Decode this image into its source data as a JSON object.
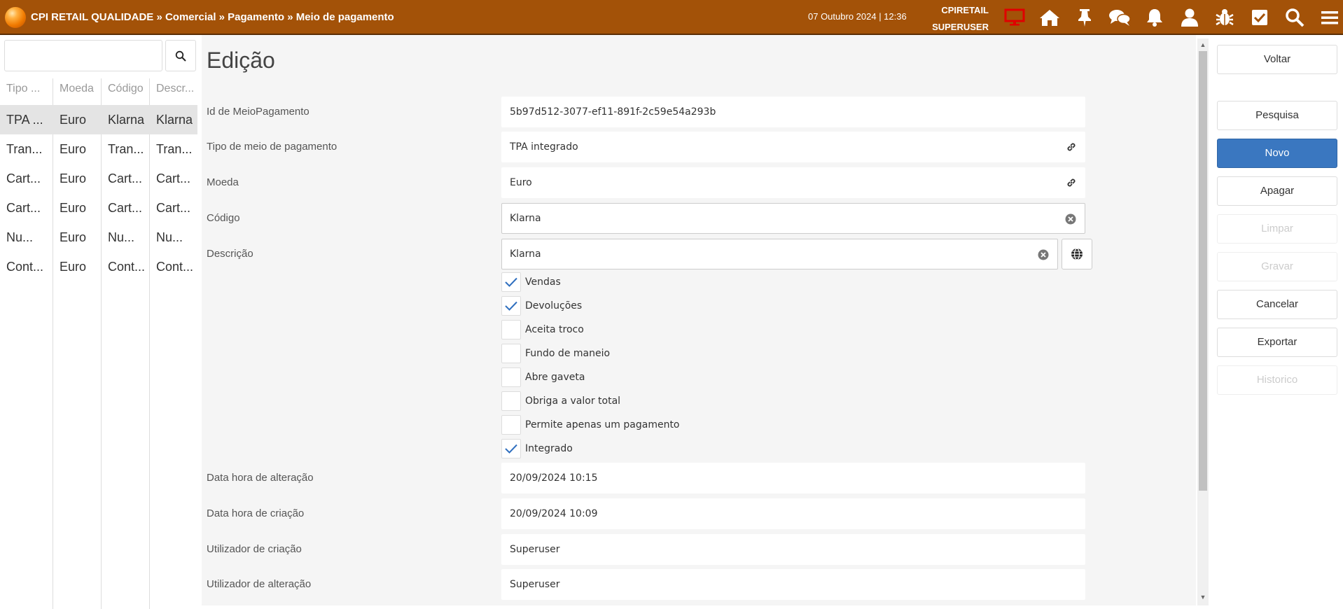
{
  "header": {
    "breadcrumb": "CPI RETAIL QUALIDADE » Comercial » Pagamento » Meio de pagamento",
    "datetime": "07 Outubro 2024 | 12:36",
    "company": "CPIRETAIL",
    "user": "SUPERUSER",
    "icons": [
      "monitor-icon",
      "home-icon",
      "pin-icon",
      "chat-icon",
      "bell-icon",
      "user-icon",
      "bug-icon",
      "checkbox-icon",
      "search-icon",
      "menu-icon"
    ],
    "monitor_color": "#e00000"
  },
  "list": {
    "search_value": "",
    "columns": [
      "Tipo ...",
      "Moeda",
      "Código",
      "Descr..."
    ],
    "rows": [
      [
        "TPA ...",
        "Euro",
        "Klarna",
        "Klarna"
      ],
      [
        "Tran...",
        "Euro",
        "Tran...",
        "Tran..."
      ],
      [
        "Cart...",
        "Euro",
        "Cart...",
        "Cart..."
      ],
      [
        "Cart...",
        "Euro",
        "Cart...",
        "Cart..."
      ],
      [
        "Nu...",
        "Euro",
        "Nu...",
        "Nu..."
      ],
      [
        "Cont...",
        "Euro",
        "Cont...",
        "Cont..."
      ]
    ],
    "selected_row": 0
  },
  "form": {
    "title": "Edição",
    "fields": {
      "id": {
        "label": "Id de MeioPagamento",
        "value": "5b97d512-3077-ef11-891f-2c59e54a293b"
      },
      "tipo": {
        "label": "Tipo de meio de pagamento",
        "value": "TPA integrado"
      },
      "moeda": {
        "label": "Moeda",
        "value": "Euro"
      },
      "codigo": {
        "label": "Código",
        "value": "Klarna"
      },
      "descricao": {
        "label": "Descrição",
        "value": "Klarna"
      },
      "data_alteracao": {
        "label": "Data hora de alteração",
        "value": "20/09/2024 10:15"
      },
      "data_criacao": {
        "label": "Data hora de criação",
        "value": "20/09/2024 10:09"
      },
      "util_criacao": {
        "label": "Utilizador de criação",
        "value": "Superuser"
      },
      "util_alteracao": {
        "label": "Utilizador de alteração",
        "value": "Superuser"
      }
    },
    "checkboxes": [
      {
        "label": "Vendas",
        "checked": true
      },
      {
        "label": "Devoluções",
        "checked": true
      },
      {
        "label": "Aceita troco",
        "checked": false
      },
      {
        "label": "Fundo de maneio",
        "checked": false
      },
      {
        "label": "Abre gaveta",
        "checked": false
      },
      {
        "label": "Obriga a valor total",
        "checked": false
      },
      {
        "label": "Permite apenas um pagamento",
        "checked": false
      },
      {
        "label": "Integrado",
        "checked": true
      }
    ]
  },
  "actions": {
    "voltar": "Voltar",
    "pesquisa": "Pesquisa",
    "novo": "Novo",
    "apagar": "Apagar",
    "limpar": "Limpar",
    "gravar": "Gravar",
    "cancelar": "Cancelar",
    "exportar": "Exportar",
    "historico": "Historico",
    "primary_color": "#3a77c0"
  }
}
